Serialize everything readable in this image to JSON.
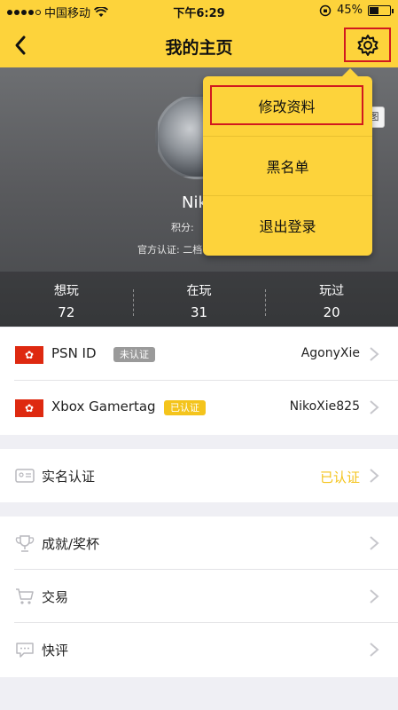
{
  "status_bar": {
    "carrier": "中国移动",
    "time": "下午6:29",
    "battery": "45%",
    "battery_level": 0.45
  },
  "nav": {
    "title": "我的主页"
  },
  "header": {
    "nickname": "Nik",
    "points_prefix": "积分: ",
    "cert_prefix": "官方认证: 二档",
    "edge_glyph": "图"
  },
  "stats": [
    {
      "label": "想玩",
      "value": "72"
    },
    {
      "label": "在玩",
      "value": "31"
    },
    {
      "label": "玩过",
      "value": "20"
    }
  ],
  "dropdown": {
    "items": [
      {
        "label": "修改资料"
      },
      {
        "label": "黑名单"
      },
      {
        "label": "退出登录"
      }
    ]
  },
  "accounts": [
    {
      "label": "PSN ID",
      "tag": "未认证",
      "value": "AgonyXie"
    },
    {
      "label": "Xbox Gamertag",
      "tag": "已认证",
      "value": "NikoXie825"
    }
  ],
  "verification": {
    "label": "实名认证",
    "value": "已认证"
  },
  "menu": [
    {
      "label": "成就/奖杯"
    },
    {
      "label": "交易"
    },
    {
      "label": "快评"
    }
  ],
  "colors": {
    "accent": "#fdd33b",
    "highlight_border": "#d1191f",
    "verified": "#f4c41c",
    "unverified": "#9a9a9a"
  }
}
